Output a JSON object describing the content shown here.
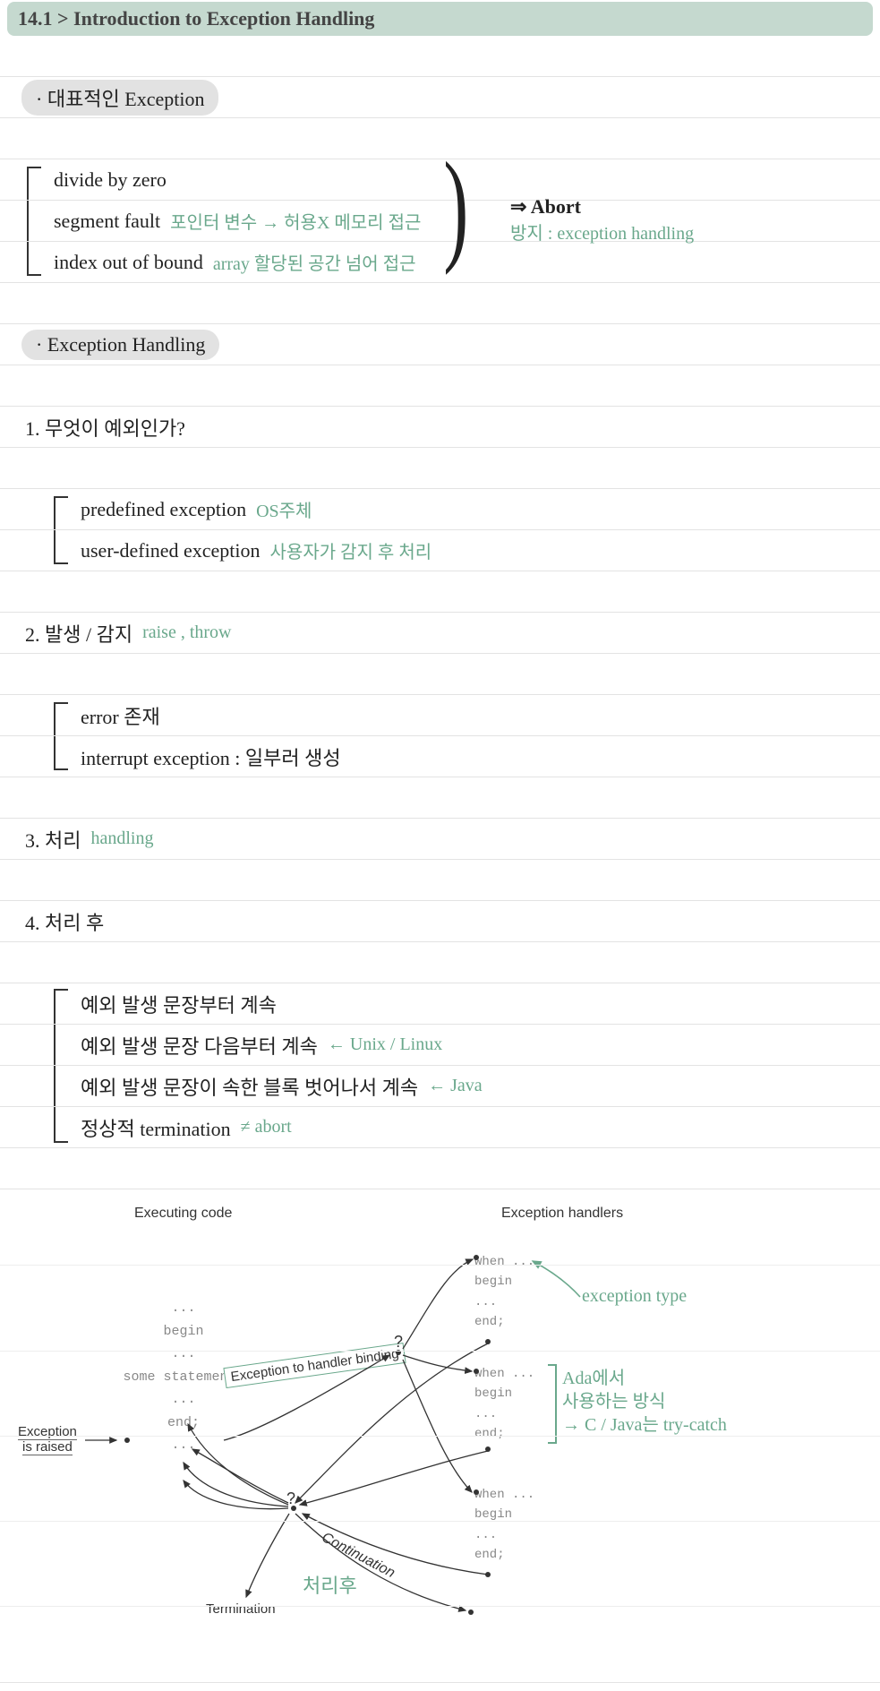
{
  "header": {
    "title": "14.1 > Introduction to Exception Handling"
  },
  "section1": {
    "pill": "· 대표적인 Exception",
    "items": [
      {
        "main": "divide by zero",
        "note": ""
      },
      {
        "main": "segment fault",
        "note": "포인터 변수 → 허용X 메모리 접근"
      },
      {
        "main": "index out of bound",
        "note": "array 할당된 공간 넘어 접근"
      }
    ],
    "result_arrow": "⇒ Abort",
    "result_note": "방지 : exception handling"
  },
  "section2": {
    "pill": "· Exception Handling",
    "q1": {
      "label": "1. 무엇이 예외인가?",
      "items": [
        {
          "main": "predefined exception",
          "note": "OS주체"
        },
        {
          "main": "user-defined exception",
          "note": "사용자가 감지 후 처리"
        }
      ]
    },
    "q2": {
      "label": "2. 발생 / 감지",
      "green": "raise , throw",
      "items": [
        {
          "main": "error 존재"
        },
        {
          "main": "interrupt exception : 일부러 생성"
        }
      ]
    },
    "q3": {
      "label": "3. 처리",
      "green": "handling"
    },
    "q4": {
      "label": "4. 처리 후",
      "items": [
        {
          "main": "예외 발생 문장부터 계속",
          "note": ""
        },
        {
          "main": "예외 발생 문장 다음부터 계속",
          "note": "← Unix / Linux"
        },
        {
          "main": "예외 발생 문장이 속한  블록  벗어나서 계속",
          "note": "← Java"
        },
        {
          "main": "정상적 termination",
          "note": "≠ abort"
        }
      ]
    }
  },
  "diagram": {
    "left_title": "Executing code",
    "right_title": "Exception handlers",
    "exc_raised": "Exception is raised",
    "binding": "Exception to handler binding",
    "continuation": "Continuation",
    "termination": "Termination",
    "code_lines": [
      "...",
      "begin",
      "...",
      "some statement;",
      "...",
      "end;",
      "..."
    ],
    "handler_lines": [
      "when ...",
      "  begin",
      "    ...",
      "  end;"
    ],
    "annot_exc_type": "exception type",
    "annot_ada1": "Ada에서",
    "annot_ada2": "사용하는 방식",
    "annot_ada3": "→ C / Java는 try-catch",
    "annot_after": "처리후",
    "q_mark": "?"
  }
}
